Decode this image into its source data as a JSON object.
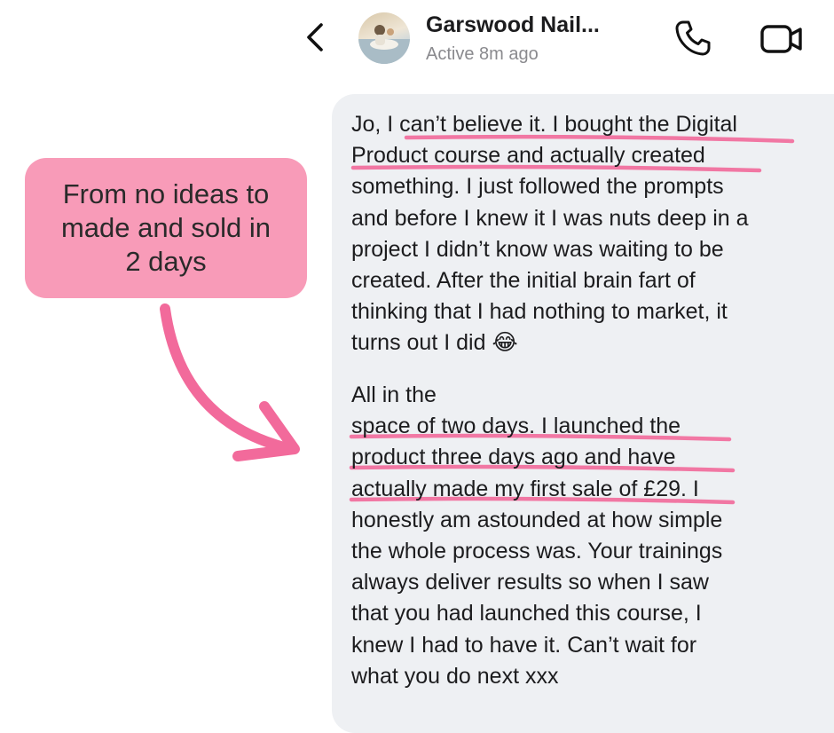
{
  "header": {
    "contact_name": "Garswood Nail...",
    "status": "Active 8m ago"
  },
  "icons": {
    "back": "chevron-left-icon",
    "call": "phone-icon",
    "video": "video-camera-icon",
    "emoji": "tears-of-joy-emoji"
  },
  "message": {
    "paragraph1": "Jo, I can’t believe it. I bought the Digital\nProduct course and actually created\nsomething. I just followed the prompts\nand before I knew it I was nuts deep in a\nproject I didn’t know was waiting to be\ncreated. After the initial brain fart of\nthinking that I had nothing to market, it\nturns out I did",
    "emoji": "😂",
    "paragraph2": "All in the\nspace of two days. I launched the\nproduct three days ago and have\nactually made my first sale of £29. I\nhonestly am astounded at how simple\nthe whole process was. Your trainings\nalways deliver results so when I saw\nthat you had launched this course, I\nknew I had to have it. Can’t wait for\nwhat you do next xxx"
  },
  "annotation": {
    "text": "From no ideas to\nmade and sold in\n2 days"
  },
  "colors": {
    "highlight": "#f26a9b",
    "callout": "#f89bb8",
    "bubble": "#eef0f3"
  }
}
